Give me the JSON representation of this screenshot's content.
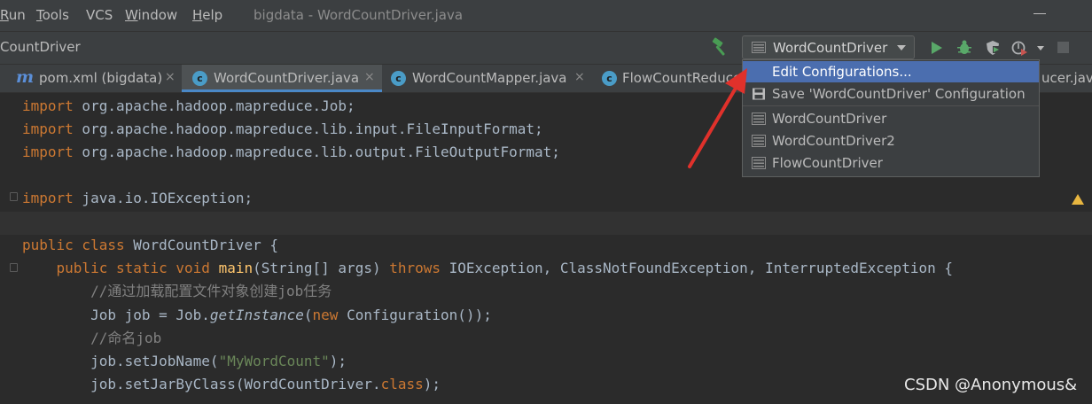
{
  "menu": {
    "items": [
      {
        "label": "Run",
        "accel": "R"
      },
      {
        "label": "Tools",
        "accel": "T"
      },
      {
        "label": "VCS",
        "accel": ""
      },
      {
        "label": "Window",
        "accel": "W"
      },
      {
        "label": "Help",
        "accel": "H"
      }
    ],
    "window_title": "bigdata - WordCountDriver.java"
  },
  "navbar": {
    "title": "CountDriver",
    "run_config": "WordCountDriver"
  },
  "tabs": [
    {
      "label": "pom.xml (bigdata)",
      "icon": "maven-icon",
      "close": "×"
    },
    {
      "label": "WordCountDriver.java",
      "icon": "class-icon",
      "close": "×"
    },
    {
      "label": "WordCountMapper.java",
      "icon": "class-icon",
      "close": "×"
    },
    {
      "label": "FlowCountReduce",
      "icon": "class-icon"
    },
    {
      "label": "ucer.java"
    }
  ],
  "icon_glyphs": {
    "maven": "m",
    "class": "c"
  },
  "popup": {
    "items": [
      {
        "label": "Edit Configurations...",
        "selected": true
      },
      {
        "label": "Save 'WordCountDriver' Configuration",
        "icon": "save-icon"
      },
      {
        "label": "WordCountDriver",
        "icon": "config-icon"
      },
      {
        "label": "WordCountDriver2",
        "icon": "config-icon"
      },
      {
        "label": "FlowCountDriver",
        "icon": "config-icon"
      }
    ]
  },
  "code": {
    "l1_kw": "import",
    "l1_rest": " org.apache.hadoop.mapreduce.Job;",
    "l2_kw": "import",
    "l2_rest": " org.apache.hadoop.mapreduce.lib.input.FileInputFormat;",
    "l3_kw": "import",
    "l3_rest": " org.apache.hadoop.mapreduce.lib.output.FileOutputFormat;",
    "l5_kw": "import",
    "l5_rest": " java.io.IOException;",
    "l7_kw": "public class",
    "l7_rest": " WordCountDriver {",
    "l8_indent": "    ",
    "l8_kw1": "public static void",
    "l8_sp": " ",
    "l8_fn": "main",
    "l8_a": "(String[] args) ",
    "l8_kw2": "throws",
    "l8_b": " IOException, ClassNotFoundException, InterruptedException {",
    "l9": "        //通过加载配置文件对象创建job任务",
    "l10_a": "        Job job = Job.",
    "l10_it": "getInstance",
    "l10_b": "(",
    "l10_kw": "new",
    "l10_c": " Configuration());",
    "l11": "        //命名job",
    "l12_a": "        job.setJobName(",
    "l12_str": "\"MyWordCount\"",
    "l12_b": ");",
    "l13_a": "        job.setJarByClass(WordCountDriver.",
    "l13_kw": "class",
    "l13_b": ");"
  },
  "watermark": "CSDN @Anonymous&",
  "colors": {
    "accent": "#4b6eaf",
    "arrow": "#e0312b",
    "run_green": "#59a869"
  }
}
